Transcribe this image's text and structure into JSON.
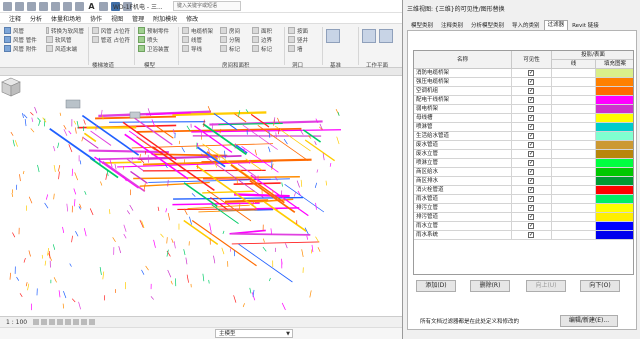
{
  "app": {
    "window_title": "WD-1F机电 - 三...",
    "search_placeholder": "键入关键字或短语",
    "quick_access_letter": "A",
    "menu": [
      "注释",
      "分析",
      "体量和场地",
      "协作",
      "视图",
      "管理",
      "附加模块",
      "修改"
    ],
    "ribbon": {
      "group1_rows": [
        "风管",
        "风管 管件",
        "风管 附件"
      ],
      "group2_rows": [
        "转换为软风管",
        "软风管",
        "风道末端"
      ],
      "group3_rows": [
        "风管 占位符",
        "管道 占位符"
      ],
      "group4_rows": [
        "预制零件",
        "喷头",
        "卫浴装置"
      ],
      "group5_rows": [
        "电缆桥架",
        "线管",
        "导线"
      ],
      "group6_rows": [
        "房间",
        "分隔",
        "标记"
      ],
      "group7_rows": [
        "面积",
        "边界",
        "标记"
      ],
      "group8_rows": [
        "按面",
        "竖井",
        "墙"
      ],
      "labels": [
        "楼梯坡道",
        "模型",
        "房间和面积",
        "洞口",
        "基准",
        "工作平面"
      ]
    },
    "scale": "1 : 100",
    "model_selector": "主模型"
  },
  "dialog": {
    "title": "三维视图: {三维}的可见性/图形替换",
    "tabs": [
      "模型类别",
      "注释类别",
      "分析模型类别",
      "导入的类别",
      "过滤器",
      "Revit 链接"
    ],
    "active_tab": "过滤器",
    "columns": {
      "name": "名称",
      "visibility": "可见性",
      "projection": "投影/表面",
      "line": "线",
      "fill": "填充图案"
    },
    "filters": [
      {
        "name": "消防电缆桥架",
        "visible": true,
        "color": "#d9ef8b"
      },
      {
        "name": "强压电缆桥架",
        "visible": true,
        "color": "#ff8000"
      },
      {
        "name": "空调机组",
        "visible": true,
        "color": "#ff6a00"
      },
      {
        "name": "配电干线桥架",
        "visible": true,
        "color": "#ff00ff"
      },
      {
        "name": "弱电桥架",
        "visible": true,
        "color": "#cc33cc"
      },
      {
        "name": "母线槽",
        "visible": true,
        "color": "#ffff00"
      },
      {
        "name": "喷淋管",
        "visible": true,
        "color": "#00cccc"
      },
      {
        "name": "生活给水管道",
        "visible": true,
        "color": "#80ffd0"
      },
      {
        "name": "废水管道",
        "visible": true,
        "color": "#cc9933"
      },
      {
        "name": "废水立管",
        "visible": true,
        "color": "#b8860b"
      },
      {
        "name": "喷淋立管",
        "visible": true,
        "color": "#00ff40"
      },
      {
        "name": "商区给水",
        "visible": true,
        "color": "#00c800"
      },
      {
        "name": "商区排水",
        "visible": true,
        "color": "#009933"
      },
      {
        "name": "消火栓管道",
        "visible": true,
        "color": "#ff0000"
      },
      {
        "name": "雨水管道",
        "visible": true,
        "color": "#00ee66"
      },
      {
        "name": "排污立管",
        "visible": true,
        "color": "#ffff00"
      },
      {
        "name": "排污管道",
        "visible": true,
        "color": "#ffee00"
      },
      {
        "name": "雨水立管",
        "visible": true,
        "color": "#0000ff"
      },
      {
        "name": "雨水系统",
        "visible": true,
        "color": "#0000ee"
      }
    ],
    "buttons": {
      "add": "添加(D)",
      "delete": "删除(R)",
      "up": "向上(U)",
      "down": "向下(O)",
      "edit": "编辑/新建(E)..."
    },
    "note": "所有文档过滤器都是在此处定义和修改的"
  }
}
